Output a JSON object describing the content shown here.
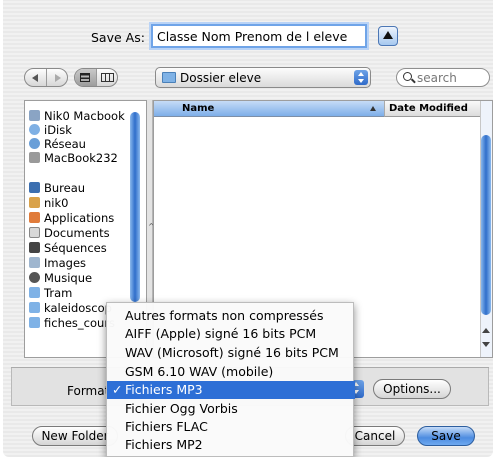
{
  "save_as": {
    "label": "Save As:",
    "filename": "Classe Nom Prenom de l eleve"
  },
  "toolbar": {
    "location": "Dossier eleve",
    "search_placeholder": "search"
  },
  "sidebar": {
    "items": [
      {
        "label": "Nik0 Macbook",
        "icon": "computer-icon"
      },
      {
        "label": "iDisk",
        "icon": "idisk-icon"
      },
      {
        "label": "Réseau",
        "icon": "network-icon"
      },
      {
        "label": "MacBook232",
        "icon": "harddisk-icon"
      },
      {
        "label": "Bureau",
        "icon": "desktop-icon"
      },
      {
        "label": "nik0",
        "icon": "home-icon"
      },
      {
        "label": "Applications",
        "icon": "applications-icon"
      },
      {
        "label": "Documents",
        "icon": "documents-icon"
      },
      {
        "label": "Séquences",
        "icon": "movies-icon"
      },
      {
        "label": "Images",
        "icon": "pictures-icon"
      },
      {
        "label": "Musique",
        "icon": "music-icon"
      },
      {
        "label": "Tram",
        "icon": "folder-icon"
      },
      {
        "label": "kaleidoscop",
        "icon": "folder-icon"
      },
      {
        "label": "fiches_cours",
        "icon": "folder-icon"
      }
    ]
  },
  "file_list": {
    "columns": [
      "Name",
      "Date Modified"
    ]
  },
  "format": {
    "label": "Format:",
    "options": [
      "Autres formats non compressés",
      "AIFF (Apple) signé 16 bits PCM",
      "WAV (Microsoft) signé 16 bits PCM",
      "GSM 6.10 WAV (mobile)",
      "Fichiers MP3",
      "Fichier Ogg Vorbis",
      "Fichiers FLAC",
      "Fichiers MP2"
    ],
    "selected_index": 4,
    "check": "✓"
  },
  "buttons": {
    "options": "Options...",
    "new_folder": "New Folder",
    "cancel": "Cancel",
    "save": "Save"
  },
  "colors": {
    "accent": "#2d6fd6",
    "focus_ring": "#6fa4e8"
  }
}
